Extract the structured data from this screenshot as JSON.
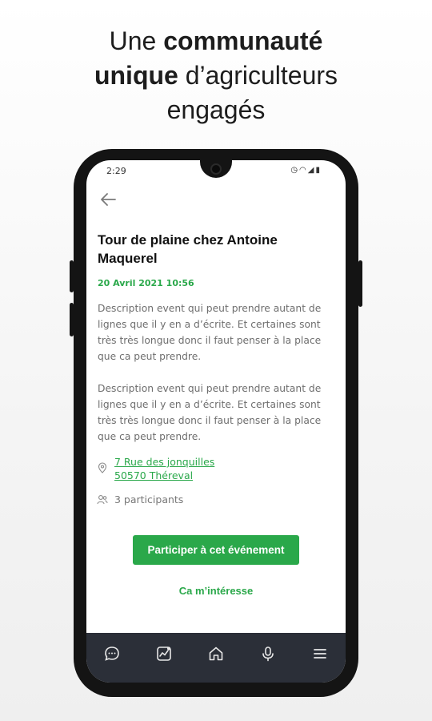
{
  "headline": {
    "line1_regular": "Une ",
    "line1_bold": "communauté",
    "line2_bold": "unique",
    "line2_regular": " d’agriculteurs",
    "line3_regular": "engagés"
  },
  "status_bar": {
    "time": "2:29",
    "icons": [
      "clock-icon",
      "wifi-icon",
      "signal-icon",
      "battery-icon"
    ]
  },
  "event": {
    "title": "Tour de plaine chez Antoine Maquerel",
    "date": "20 Avril 2021 10:56",
    "description_1": "Description event qui peut prendre autant de lignes que il y en a d’écrite. Et certaines sont très très longue donc il faut penser à la place que ca peut prendre.",
    "description_2": "Description event qui peut prendre autant de lignes que il y en a d’écrite. Et certaines sont très très longue donc il faut penser à la place que ca peut prendre.",
    "address_line1": "7 Rue des jonquilles",
    "address_line2": "50570 Théreval",
    "participants": "3 participants"
  },
  "actions": {
    "participate_label": "Participer à cet événement",
    "interest_label": "Ca m’intéresse"
  },
  "nav": {
    "items": [
      "chat-icon",
      "stats-icon",
      "home-icon",
      "microphone-icon",
      "menu-icon"
    ]
  },
  "colors": {
    "accent": "#2aa84a",
    "navbar": "#2b2f38",
    "phone_frame": "#141414"
  }
}
